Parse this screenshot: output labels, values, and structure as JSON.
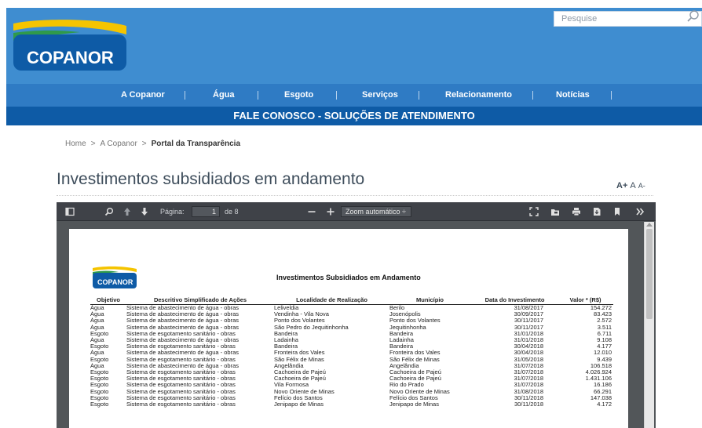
{
  "header": {
    "logo_text": "COPANOR",
    "search_placeholder": "Pesquise"
  },
  "nav": {
    "items": [
      "A Copanor",
      "Água",
      "Esgoto",
      "Serviços",
      "Relacionamento",
      "Notícias"
    ]
  },
  "banner": {
    "text": "FALE CONOSCO - SOLUÇÕES DE ATENDIMENTO"
  },
  "breadcrumb": {
    "items": [
      "Home",
      "A Copanor",
      "Portal da Transparência"
    ],
    "separator": ">"
  },
  "page": {
    "title": "Investimentos subsidiados em andamento",
    "font_controls": [
      "A+",
      "A",
      "A-"
    ]
  },
  "viewer": {
    "page_label": "Página:",
    "current_page": "1",
    "total_pages": "de 8",
    "zoom_label": "Zoom automático ÷"
  },
  "document": {
    "logo_text": "COPANOR",
    "title": "Investimentos Subsidiados em Andamento",
    "columns": [
      "Objetivo",
      "Descritivo Simplificado de Ações",
      "Localidade de Realização",
      "Município",
      "Data do Investimento",
      "Valor * (R$)"
    ],
    "rows": [
      [
        "Água",
        "Sistema de abastecimento de água - obras",
        "Leliveldia",
        "Berilo",
        "31/08/2017",
        "154.272"
      ],
      [
        "Água",
        "Sistema de abastecimento de água - obras",
        "Vendinha - Vila Nova",
        "Josenópolis",
        "30/09/2017",
        "83.423"
      ],
      [
        "Água",
        "Sistema de abastecimento de água - obras",
        "Ponto dos Volantes",
        "Ponto dos Volantes",
        "30/11/2017",
        "2.572"
      ],
      [
        "Água",
        "Sistema de abastecimento de água - obras",
        "São Pedro do Jequitinhonha",
        "Jequitinhonha",
        "30/11/2017",
        "3.511"
      ],
      [
        "Esgoto",
        "Sistema de esgotamento sanitário - obras",
        "Bandeira",
        "Bandeira",
        "31/01/2018",
        "6.711"
      ],
      [
        "Água",
        "Sistema de abastecimento de água - obras",
        "Ladainha",
        "Ladainha",
        "31/01/2018",
        "9.108"
      ],
      [
        "Esgoto",
        "Sistema de esgotamento sanitário - obras",
        "Bandeira",
        "Bandeira",
        "30/04/2018",
        "4.177"
      ],
      [
        "Água",
        "Sistema de abastecimento de água - obras",
        "Fronteira dos Vales",
        "Fronteira dos Vales",
        "30/04/2018",
        "12.010"
      ],
      [
        "Esgoto",
        "Sistema de esgotamento sanitário - obras",
        "São Félix de Minas",
        "São Félix de Minas",
        "31/05/2018",
        "9.439"
      ],
      [
        "Água",
        "Sistema de abastecimento de água - obras",
        "Angelândia",
        "Angelândia",
        "31/07/2018",
        "106.518"
      ],
      [
        "Esgoto",
        "Sistema de esgotamento sanitário - obras",
        "Cachoeira de Pajeú",
        "Cachoeira de Pajeú",
        "31/07/2018",
        "4.026.924"
      ],
      [
        "Esgoto",
        "Sistema de esgotamento sanitário - obras",
        "Cachoeira de Pajeú",
        "Cachoeira de Pajeú",
        "31/07/2018",
        "1.431.106"
      ],
      [
        "Esgoto",
        "Sistema de esgotamento sanitário - obras",
        "Vila Formosa",
        "Rio do Prado",
        "31/07/2018",
        "16.186"
      ],
      [
        "Esgoto",
        "Sistema de esgotamento sanitário - obras",
        "Novo Oriente de Minas",
        "Novo Oriente de Minas",
        "31/08/2018",
        "66.291"
      ],
      [
        "Esgoto",
        "Sistema de esgotamento sanitário - obras",
        "Felício dos Santos",
        "Felício dos Santos",
        "30/11/2018",
        "147.038"
      ],
      [
        "Esgoto",
        "Sistema de esgotamento sanitário - obras",
        "Jenipapo de Minas",
        "Jenipapo de Minas",
        "30/11/2018",
        "4.172"
      ]
    ]
  },
  "colors": {
    "header_blue": "#3f8dd0",
    "nav_blue": "#2f7bc4",
    "banner_blue": "#0e5ba6",
    "logo_yellow": "#f5c400",
    "viewer_toolbar": "#3f4248"
  }
}
